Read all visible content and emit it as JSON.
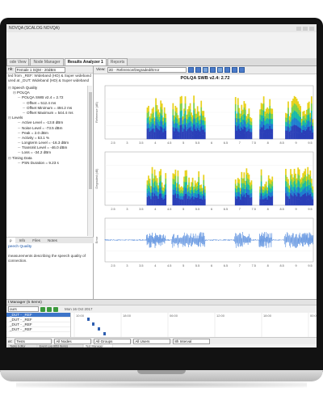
{
  "window": {
    "title": "NOVQA (SCALOG NOVQA)",
    "tabs": [
      {
        "label": "ode View",
        "active": false
      },
      {
        "label": "Node Manager",
        "active": false
      },
      {
        "label": "Results Analyzer 1",
        "active": true
      },
      {
        "label": "Reports",
        "active": false
      }
    ]
  },
  "left": {
    "mode_label": "nk:",
    "mode_value": "Female 1 SQM - 20dBm",
    "desc_lines": [
      "ted from _REF: Wideband (HD) & Super wideband",
      "ured at _DUT: Wideband (HD) & Super wideband"
    ],
    "tree": [
      {
        "indent": 0,
        "text": "Speech Quality"
      },
      {
        "indent": 1,
        "text": "POLQA"
      },
      {
        "indent": 2,
        "text": "POLQA SWB v2.4 = 2.72"
      },
      {
        "indent": 3,
        "text": "Offset = 512.4 ms"
      },
      {
        "indent": 3,
        "text": "Offset Minimum = 494.2 ms"
      },
      {
        "indent": 3,
        "text": "Offset Maximum = 544.4 ms"
      },
      {
        "indent": 0,
        "text": "Levels"
      },
      {
        "indent": 2,
        "text": "Active Level = -13.8 dBm"
      },
      {
        "indent": 2,
        "text": "Noise Level = -73.5 dBm"
      },
      {
        "indent": 2,
        "text": "Peak = 2.0 dBm"
      },
      {
        "indent": 2,
        "text": "Activity = 53.1 %"
      },
      {
        "indent": 2,
        "text": "Longterm Level = -16.3 dBm"
      },
      {
        "indent": 2,
        "text": "Transmit Level = -46.0 dBm"
      },
      {
        "indent": 2,
        "text": "Loss = -34.2 dBm"
      },
      {
        "indent": 0,
        "text": "Timing Data"
      },
      {
        "indent": 2,
        "text": "PSN Duration = 9.23 s"
      }
    ],
    "bottom_tabs": [
      "p",
      "Info",
      "Files",
      "Notes"
    ],
    "bottom_title": "peech Quality",
    "bottom_desc_1": "measurements describing the speech quality of",
    "bottom_desc_2": "connection."
  },
  "graph": {
    "view_label": "View:",
    "view_value": "2D - Reference/Degraded/Error",
    "title": "POLQA SWB v2.4: 2.72",
    "y_labels": [
      "Reference (dB)",
      "Degraded (dB)",
      "Error"
    ],
    "x_ticks": [
      "2.5",
      "3",
      "3.5",
      "4",
      "4.5",
      "5",
      "5.5",
      "6",
      "6.5",
      "7",
      "7.5",
      "8",
      "8.5",
      "9",
      "9.5"
    ]
  },
  "manager": {
    "title": "t Manager (5 Items)",
    "selector": "ours",
    "date": "Mon 16 Oct 2017",
    "rows": [
      {
        "label": "_DUT - _REF",
        "selected": true
      },
      {
        "label": "_DUT - _REF",
        "selected": false
      },
      {
        "label": "_DUT - _REF",
        "selected": false
      },
      {
        "label": "_DUT - _REF",
        "selected": false
      }
    ],
    "times": [
      "10:00",
      "18:00",
      "06:00",
      "12:00",
      "18:00",
      "00:00"
    ],
    "filter_label": "er:",
    "filters": [
      "Tests",
      "All Nodes",
      "All Groups",
      "All Users",
      "8h Interval"
    ],
    "status_tabs": [
      "Tasks Editor",
      "Event Log (653 Items)",
      "Test Manager"
    ]
  },
  "colors": {
    "accent": "#3d74c9",
    "spectro_low": "#2a3fb8",
    "spectro_mid": "#18b9a8",
    "spectro_high": "#e8d11a",
    "wave": "#2a6fd6"
  }
}
